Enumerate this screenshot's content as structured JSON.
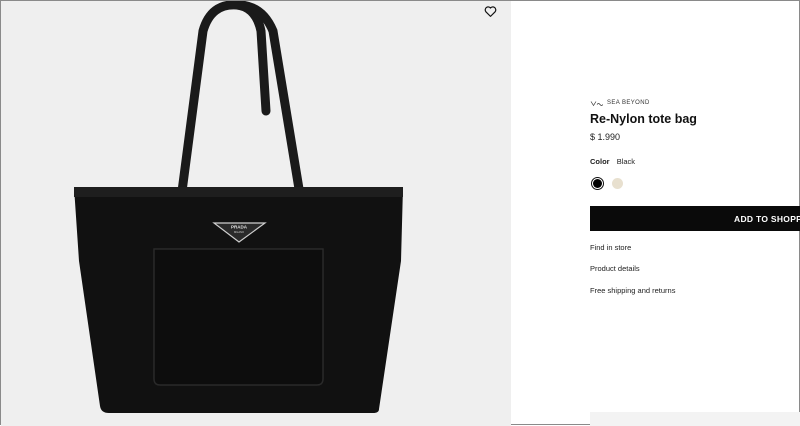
{
  "product": {
    "brand_tag": "SEA BEYOND",
    "title": "Re-Nylon tote bag",
    "price": "$ 1.990",
    "color_label": "Color",
    "color_value": "Black",
    "swatches": [
      {
        "name": "Black",
        "hex": "#000000",
        "selected": true
      },
      {
        "name": "Beige",
        "hex": "#e8e0cf",
        "selected": false
      }
    ]
  },
  "actions": {
    "add_to_bag": "ADD TO SHOPPI",
    "find_in_store": "Find in store",
    "product_details": "Product details",
    "shipping": "Free shipping and returns"
  },
  "image": {
    "logo_text_top": "PRADA",
    "logo_text_bottom": "MILANO",
    "background": "#efefef",
    "bag_color": "#111111"
  }
}
